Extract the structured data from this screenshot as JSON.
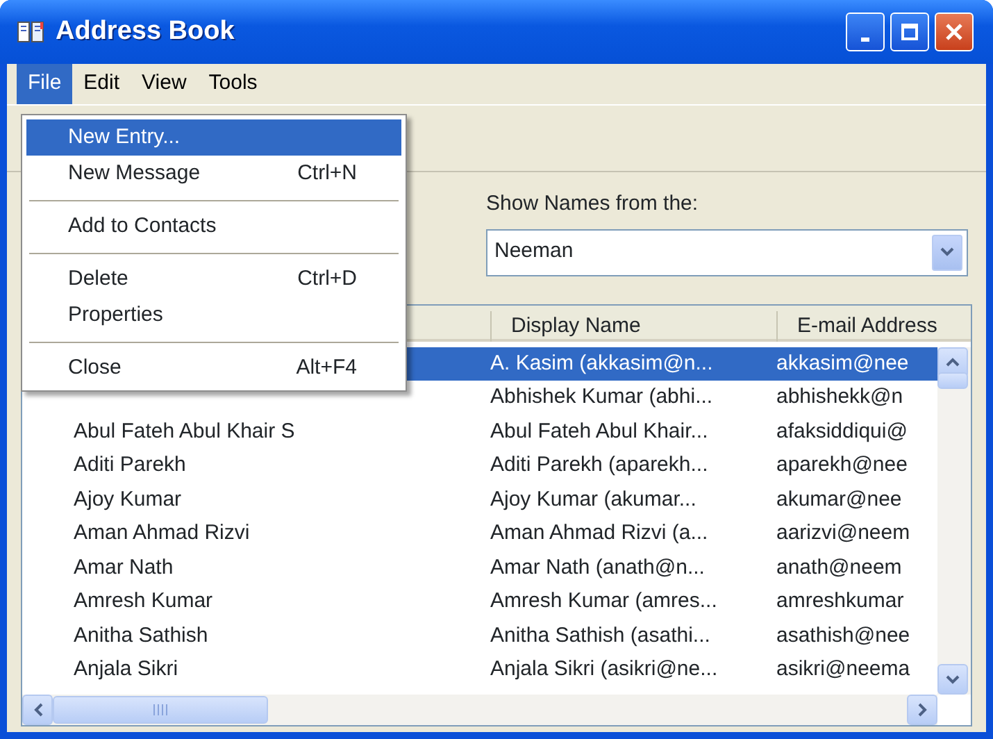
{
  "window": {
    "title": "Address Book"
  },
  "menu_bar": [
    {
      "label": "File",
      "selected": true
    },
    {
      "label": "Edit",
      "selected": false
    },
    {
      "label": "View",
      "selected": false
    },
    {
      "label": "Tools",
      "selected": false
    }
  ],
  "file_menu": [
    {
      "kind": "item",
      "label": "New Entry...",
      "selected": true
    },
    {
      "kind": "item",
      "label": "New Message",
      "shortcut": "Ctrl+N",
      "selected": false
    },
    {
      "kind": "separator"
    },
    {
      "kind": "item",
      "label": "Add to Contacts",
      "selected": false
    },
    {
      "kind": "separator"
    },
    {
      "kind": "item",
      "label": "Delete",
      "shortcut": "Ctrl+D",
      "selected": false
    },
    {
      "kind": "item",
      "label": "Properties",
      "selected": false
    },
    {
      "kind": "separator"
    },
    {
      "kind": "item",
      "label": "Close",
      "shortcut": "Alt+F4",
      "selected": false
    }
  ],
  "show_names": {
    "label": "Show Names from the:",
    "value": "Neeman"
  },
  "list": {
    "columns": [
      "Display Name",
      "E-mail Address"
    ],
    "rows": [
      {
        "display_name": "A. Kasim (akkasim@n...",
        "email": "akkasim@nee",
        "selected": true
      },
      {
        "display_name": "Abhishek Kumar (abhi...",
        "email": "abhishekk@n",
        "selected": false
      },
      {
        "name": "Abul Fateh Abul Khair S",
        "display_name": "Abul Fateh Abul Khair...",
        "email": "afaksiddiqui@",
        "selected": false
      },
      {
        "name": "Aditi Parekh",
        "display_name": "Aditi Parekh (aparekh...",
        "email": "aparekh@nee",
        "selected": false
      },
      {
        "name": "Ajoy Kumar",
        "display_name": "Ajoy Kumar (akumar...",
        "email": "akumar@nee",
        "selected": false
      },
      {
        "name": "Aman Ahmad Rizvi",
        "display_name": "Aman Ahmad Rizvi (a...",
        "email": "aarizvi@neem",
        "selected": false
      },
      {
        "name": "Amar Nath",
        "display_name": "Amar Nath (anath@n...",
        "email": "anath@neem",
        "selected": false
      },
      {
        "name": "Amresh Kumar",
        "display_name": "Amresh Kumar (amres...",
        "email": "amreshkumar",
        "selected": false
      },
      {
        "name": "Anitha Sathish",
        "display_name": "Anitha Sathish (asathi...",
        "email": "asathish@nee",
        "selected": false
      },
      {
        "name": "Anjala Sikri",
        "display_name": "Anjala Sikri (asikri@ne...",
        "email": "asikri@neema",
        "selected": false
      }
    ]
  }
}
